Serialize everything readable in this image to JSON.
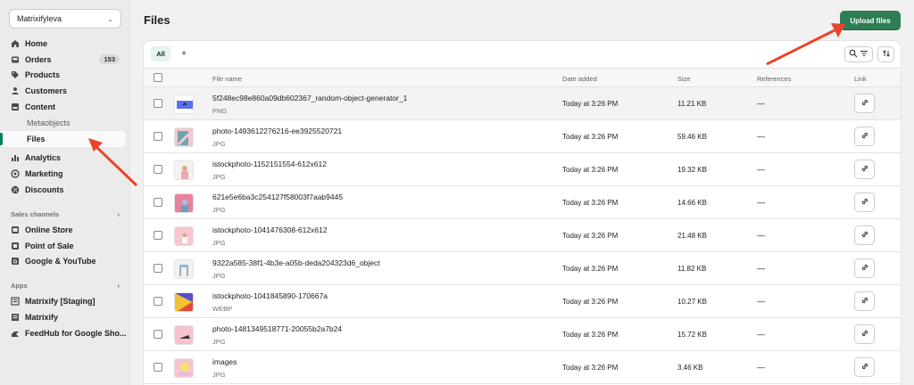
{
  "store": {
    "name": "Matrixifyleva"
  },
  "nav": {
    "home": "Home",
    "orders": "Orders",
    "orders_badge": "153",
    "products": "Products",
    "customers": "Customers",
    "content": "Content",
    "metaobjects": "Metaobjects",
    "files": "Files",
    "analytics": "Analytics",
    "marketing": "Marketing",
    "discounts": "Discounts"
  },
  "sales_channels": {
    "title": "Sales channels",
    "items": [
      "Online Store",
      "Point of Sale",
      "Google & YouTube"
    ]
  },
  "apps": {
    "title": "Apps",
    "items": [
      "Matrixify [Staging]",
      "Matrixify",
      "FeedHub for Google Sho..."
    ]
  },
  "page": {
    "title": "Files",
    "upload_label": "Upload files"
  },
  "tabs": {
    "all": "All",
    "add": "+"
  },
  "table": {
    "headers": {
      "file_name": "File name",
      "date_added": "Date added",
      "size": "Size",
      "references": "References",
      "link": "Link"
    },
    "rows": [
      {
        "name": "5f248ec98e860a09db602367_random-object-generator_1",
        "type": "PNG",
        "date": "Today at 3:26 PM",
        "size": "11.21 KB",
        "refs": "—",
        "thumb": "blue"
      },
      {
        "name": "photo-1493612276216-ee3925520721",
        "type": "JPG",
        "date": "Today at 3:26 PM",
        "size": "59.46 KB",
        "refs": "—",
        "thumb": "teal"
      },
      {
        "name": "istockphoto-1152151554-612x612",
        "type": "JPG",
        "date": "Today at 3:26 PM",
        "size": "19.32 KB",
        "refs": "—",
        "thumb": "person"
      },
      {
        "name": "621e5e6ba3c254127f58003f7aab9445",
        "type": "JPG",
        "date": "Today at 3:26 PM",
        "size": "14.66 KB",
        "refs": "—",
        "thumb": "pink"
      },
      {
        "name": "istockphoto-1041476308-612x612",
        "type": "JPG",
        "date": "Today at 3:26 PM",
        "size": "21.48 KB",
        "refs": "—",
        "thumb": "pink2"
      },
      {
        "name": "9322a585-38f1-4b3e-a05b-deda204323d6_object",
        "type": "JPG",
        "date": "Today at 3:26 PM",
        "size": "11.82 KB",
        "refs": "—",
        "thumb": "chair"
      },
      {
        "name": "istockphoto-1041845890-170667a",
        "type": "WEBP",
        "date": "Today at 3:26 PM",
        "size": "10.27 KB",
        "refs": "—",
        "thumb": "colorful"
      },
      {
        "name": "photo-1481349518771-20055b2a7b24",
        "type": "JPG",
        "date": "Today at 3:26 PM",
        "size": "15.72 KB",
        "refs": "—",
        "thumb": "pink3"
      },
      {
        "name": "images",
        "type": "JPG",
        "date": "Today at 3:26 PM",
        "size": "3.46 KB",
        "refs": "—",
        "thumb": "yellow"
      }
    ]
  },
  "colors": {
    "accent": "#2e7d55",
    "arrow": "#e8442c"
  }
}
